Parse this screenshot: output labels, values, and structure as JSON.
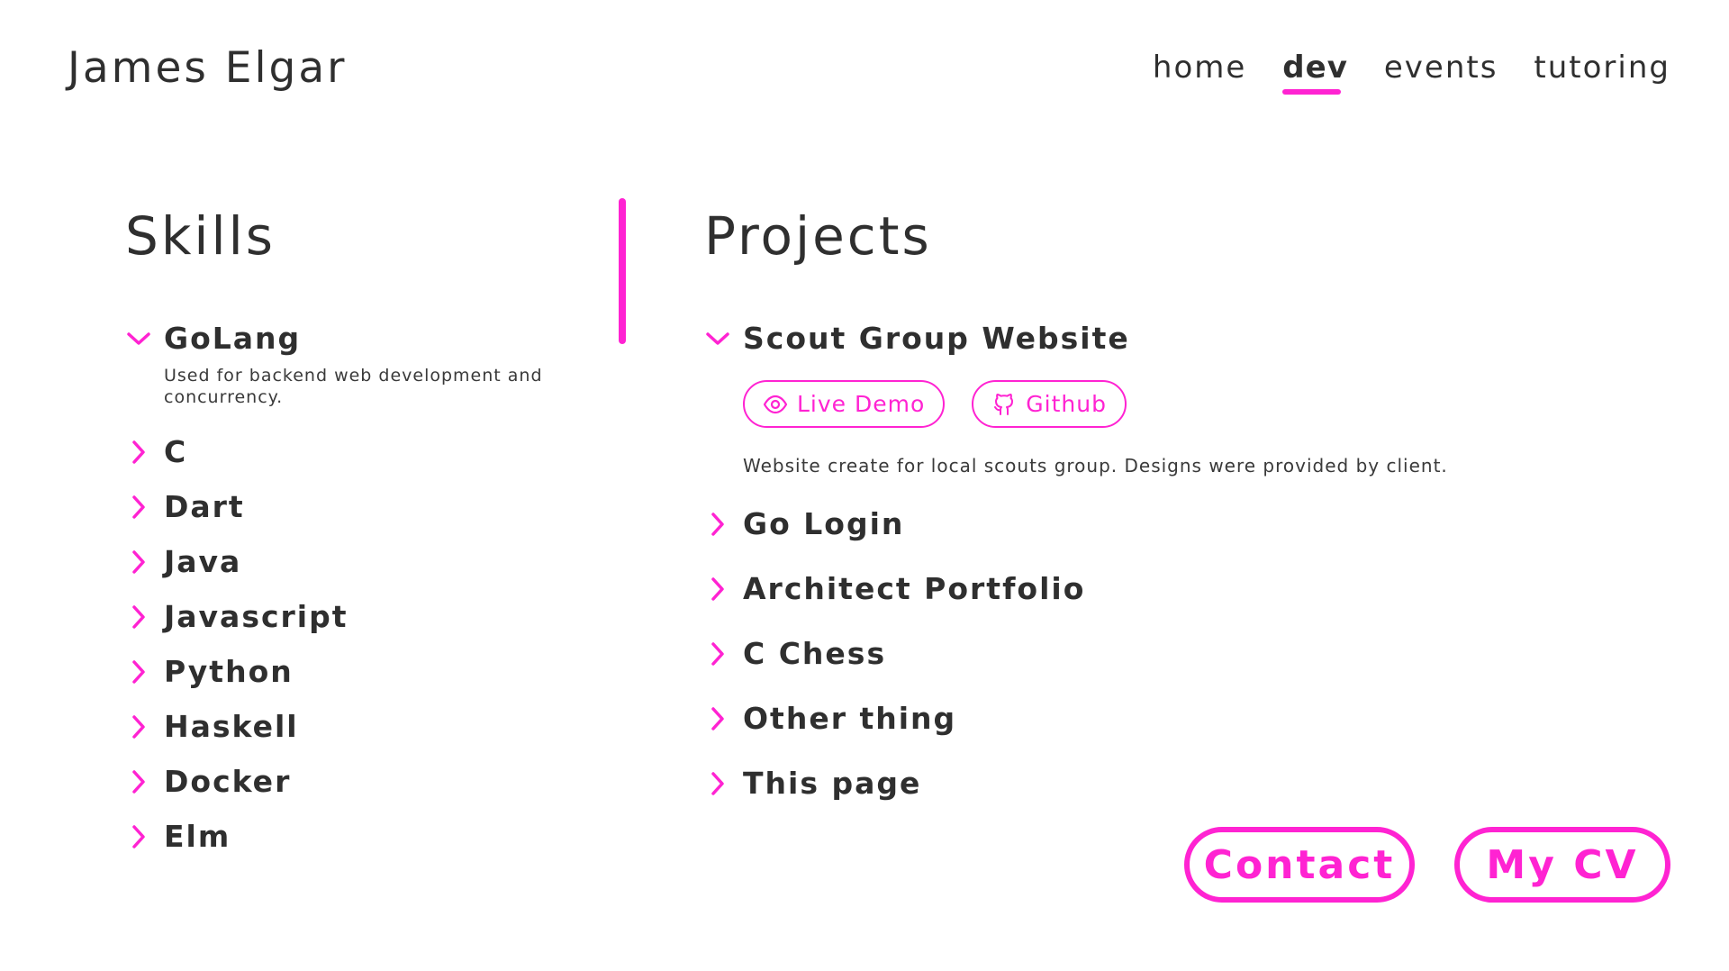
{
  "header": {
    "site_title": "James Elgar",
    "nav": [
      {
        "label": "home",
        "active": false
      },
      {
        "label": "dev",
        "active": true
      },
      {
        "label": "events",
        "active": false
      },
      {
        "label": "tutoring",
        "active": false
      }
    ]
  },
  "skills": {
    "title": "Skills",
    "items": [
      {
        "label": "GoLang",
        "expanded": true,
        "description": "Used for backend web development and concurrency."
      },
      {
        "label": "C",
        "expanded": false
      },
      {
        "label": "Dart",
        "expanded": false
      },
      {
        "label": "Java",
        "expanded": false
      },
      {
        "label": "Javascript",
        "expanded": false
      },
      {
        "label": "Python",
        "expanded": false
      },
      {
        "label": "Haskell",
        "expanded": false
      },
      {
        "label": "Docker",
        "expanded": false
      },
      {
        "label": "Elm",
        "expanded": false
      }
    ]
  },
  "projects": {
    "title": "Projects",
    "items": [
      {
        "label": "Scout Group Website",
        "expanded": true,
        "live_demo_label": "Live Demo",
        "live_demo_icon": "eye-icon",
        "github_label": "Github",
        "github_icon": "github-icon",
        "description": "Website create for local scouts group. Designs were provided by client."
      },
      {
        "label": "Go Login",
        "expanded": false
      },
      {
        "label": "Architect Portfolio",
        "expanded": false
      },
      {
        "label": "C Chess",
        "expanded": false
      },
      {
        "label": "Other thing",
        "expanded": false
      },
      {
        "label": "This page",
        "expanded": false
      }
    ]
  },
  "actions": {
    "contact_label": "Contact",
    "cv_label": "My CV"
  },
  "colors": {
    "accent": "#ff23d2",
    "text": "#2f2f2f",
    "background": "#ffffff"
  }
}
